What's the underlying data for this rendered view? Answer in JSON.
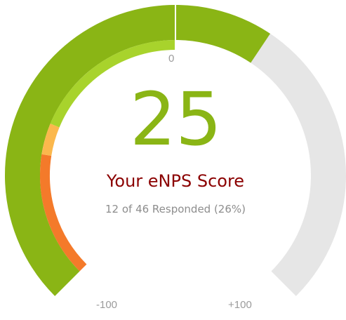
{
  "gauge": {
    "min_label": "-100",
    "zero_label": "0",
    "max_label": "+100",
    "score": "25",
    "score_number": 25,
    "title": "Your eNPS Score",
    "subtitle": "12 of 46 Responded (26%)",
    "min": -100,
    "max": 100,
    "breakdown": {
      "detractors_end": -60,
      "passives_end": -50,
      "promoters_end": 0
    },
    "colors": {
      "score_arc": "#8ab515",
      "track": "#e6e6e6",
      "detractors": "#f47a2a",
      "passives": "#fbb84d",
      "promoters": "#a8d32c",
      "score_text": "#8ab515",
      "title_text": "#8b0000",
      "label_text": "#9b9b9b"
    }
  }
}
